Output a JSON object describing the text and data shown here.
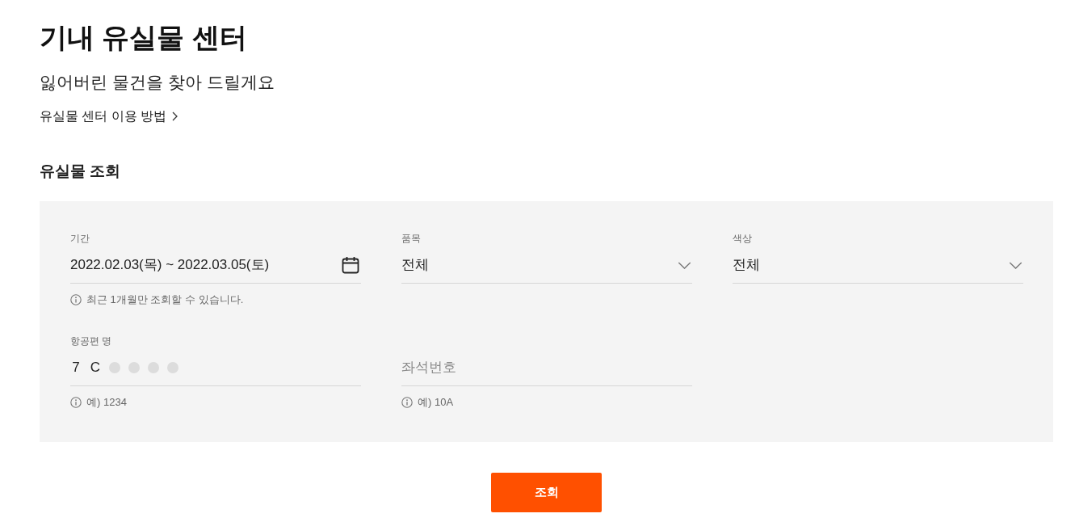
{
  "page": {
    "title": "기내 유실물 센터",
    "subtitle": "잃어버린 물건을 찾아 드릴게요",
    "guide_link": "유실물 센터 이용 방법"
  },
  "search": {
    "heading": "유실물 조회",
    "fields": [
      {
        "kind": "date",
        "label": "기간",
        "value": "2022.02.03(목) ~ 2022.03.05(토)",
        "hint": "최근 1개월만 조회할 수 있습니다."
      },
      {
        "kind": "select",
        "label": "품목",
        "value": "전체"
      },
      {
        "kind": "select",
        "label": "색상",
        "value": "전체"
      },
      {
        "kind": "masked",
        "label": "항공편 명",
        "slots": [
          {
            "filled": true,
            "char": "7"
          },
          {
            "filled": true,
            "char": "C"
          },
          {
            "filled": false
          },
          {
            "filled": false
          },
          {
            "filled": false
          },
          {
            "filled": false
          }
        ],
        "hint": "예) 1234"
      },
      {
        "kind": "text",
        "placeholder": "좌석번호",
        "hint": "예) 10A"
      }
    ],
    "button": "조회"
  }
}
